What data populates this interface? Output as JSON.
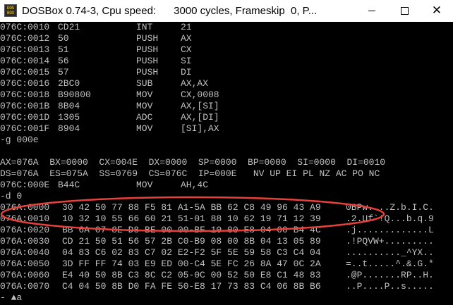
{
  "window": {
    "title": "DOSBox 0.74-3, Cpu speed:      3000 cycles, Frameskip  0, P...",
    "icon_name": "dosbox-icon",
    "icon_text": [
      "DOS",
      "BOX"
    ],
    "controls": {
      "minimize": "minimize-icon",
      "maximize": "maximize-icon",
      "close": "✕"
    }
  },
  "console": {
    "text_color": "#c0c0c0",
    "background": "#000000",
    "code": [
      {
        "addr": "076C:0010",
        "bytes": "CD21",
        "op": "INT",
        "args": "21"
      },
      {
        "addr": "076C:0012",
        "bytes": "50",
        "op": "PUSH",
        "args": "AX"
      },
      {
        "addr": "076C:0013",
        "bytes": "51",
        "op": "PUSH",
        "args": "CX"
      },
      {
        "addr": "076C:0014",
        "bytes": "56",
        "op": "PUSH",
        "args": "SI"
      },
      {
        "addr": "076C:0015",
        "bytes": "57",
        "op": "PUSH",
        "args": "DI"
      },
      {
        "addr": "076C:0016",
        "bytes": "2BC0",
        "op": "SUB",
        "args": "AX,AX"
      },
      {
        "addr": "076C:0018",
        "bytes": "B90800",
        "op": "MOV",
        "args": "CX,0008"
      },
      {
        "addr": "076C:001B",
        "bytes": "8B04",
        "op": "MOV",
        "args": "AX,[SI]"
      },
      {
        "addr": "076C:001D",
        "bytes": "1305",
        "op": "ADC",
        "args": "AX,[DI]"
      },
      {
        "addr": "076C:001F",
        "bytes": "8904",
        "op": "MOV",
        "args": "[SI],AX"
      }
    ],
    "command_g": "-g 000e",
    "registers_1": "AX=076A  BX=0000  CX=004E  DX=0000  SP=0000  BP=0000  SI=0000  DI=0010",
    "registers_2": "DS=076A  ES=075A  SS=0769  CS=076C  IP=000E   NV UP EI PL NZ AC PO NC",
    "current": {
      "addr": "076C:000E",
      "bytes": "B44C",
      "op": "MOV",
      "args": "AH,4C"
    },
    "command_d": "-d 0",
    "dump": [
      {
        "addr": "076A:0000",
        "hex": "30 42 50 77 88 F5 81 A1-5A BB 62 C8 49 96 43 A9",
        "ascii": "0BPw....Z.b.I.C."
      },
      {
        "addr": "076A:0010",
        "hex": "10 32 10 55 66 60 21 51-01 88 10 62 19 71 12 39",
        "ascii": ".2.Uf`!Q...b.q.9"
      },
      {
        "addr": "076A:0020",
        "hex": "BB 6A 07 8E D8 BE 00 00-BF 10 00 E8 04 00 B4 4C",
        "ascii": ".j.............L"
      },
      {
        "addr": "076A:0030",
        "hex": "CD 21 50 51 56 57 2B C0-B9 08 00 8B 04 13 05 89",
        "ascii": ".!PQVW+........."
      },
      {
        "addr": "076A:0040",
        "hex": "04 83 C6 02 83 C7 02 E2-F2 5F 5E 59 58 C3 C4 04",
        "ascii": ".........._^YX.."
      },
      {
        "addr": "076A:0050",
        "hex": "3D FF FF 74 03 E9 ED 00-C4 5E FC 26 8A 47 0C 2A",
        "ascii": "=..t.....^.&.G.*"
      },
      {
        "addr": "076A:0060",
        "hex": "E4 40 50 8B C3 8C C2 05-0C 00 52 50 E8 C1 48 83",
        "ascii": ".@P.......RP..H."
      },
      {
        "addr": "076A:0070",
        "hex": "C4 04 50 8B D0 FA FE 50-E8 17 73 83 C4 06 8B B6",
        "ascii": "..P....P..s....."
      }
    ],
    "prompt": "- ▲a"
  },
  "annotation": {
    "shape": "ellipse",
    "color": "#e8403a",
    "label": "highlight-ellipse"
  }
}
